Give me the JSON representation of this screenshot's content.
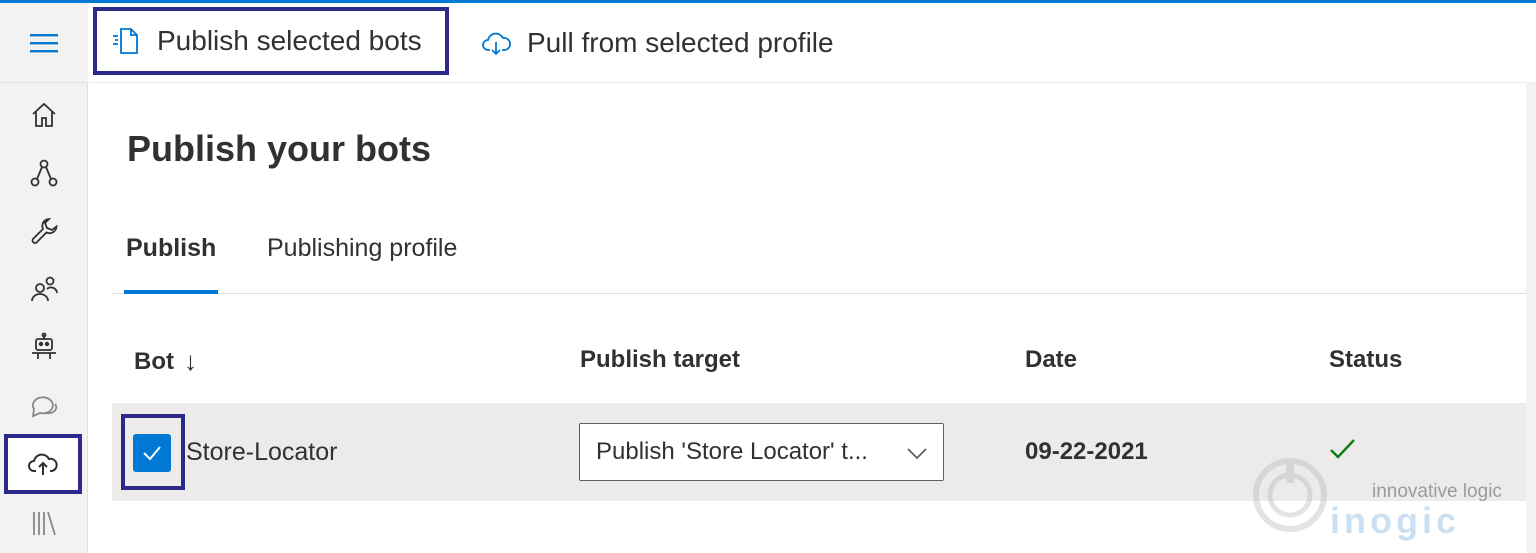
{
  "commandbar": {
    "publish_label": "Publish selected bots",
    "pull_label": "Pull from selected profile"
  },
  "rail": {
    "items": [
      {
        "icon": "hamburger-icon"
      },
      {
        "icon": "home-icon"
      },
      {
        "icon": "flow-icon"
      },
      {
        "icon": "wrench-icon"
      },
      {
        "icon": "users-icon"
      },
      {
        "icon": "bot-icon"
      },
      {
        "icon": "chat-icon"
      },
      {
        "icon": "cloud-upload-icon",
        "selected": true
      },
      {
        "icon": "library-icon"
      }
    ]
  },
  "page": {
    "title": "Publish your bots"
  },
  "tabs": [
    {
      "label": "Publish",
      "active": true
    },
    {
      "label": "Publishing profile",
      "active": false
    }
  ],
  "table": {
    "columns": [
      "Bot",
      "Publish target",
      "Date",
      "Status"
    ],
    "sort_indicator": "↓",
    "rows": [
      {
        "checked": true,
        "bot": "Store-Locator",
        "publish_target": "Publish 'Store Locator' t...",
        "date": "09-22-2021",
        "status": "success-check-icon"
      }
    ]
  },
  "watermark": {
    "tagline": "innovative logic",
    "brand": "inogic"
  },
  "colors": {
    "accent": "#0078d4",
    "highlight_frame": "#2b2a8a",
    "success": "#107c10"
  }
}
